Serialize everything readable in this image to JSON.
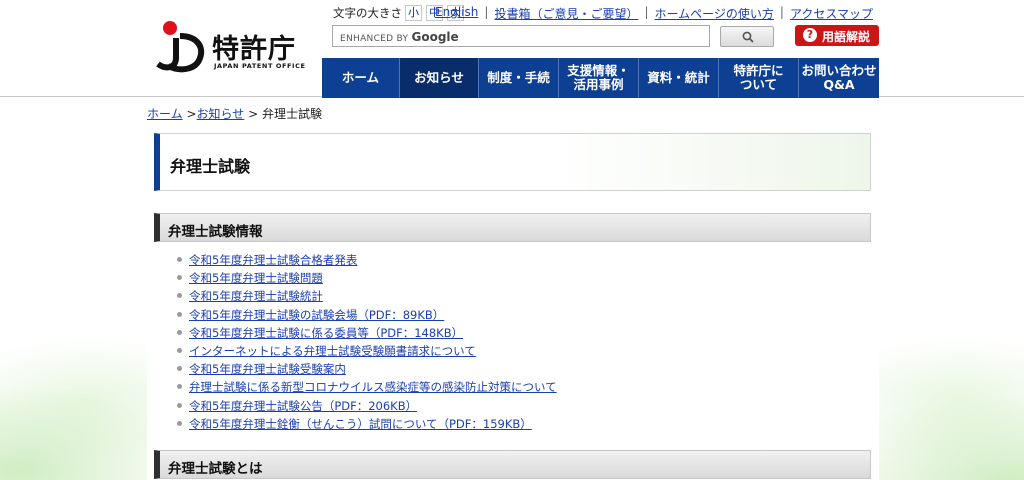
{
  "header": {
    "logo_text": "特許庁",
    "logo_subtext": "JAPAN PATENT OFFICE",
    "font_size_label": "文字の大きさ",
    "font_sizes": [
      "小",
      "中",
      "大"
    ],
    "util_links": [
      "English",
      "投書箱（ご意見・ご要望）",
      "ホームページの使い方",
      "アクセスマップ"
    ],
    "search_placeholder_prefix": "ENHANCED BY",
    "search_placeholder_brand": "Google",
    "glossary_label": "用語解説"
  },
  "nav": {
    "items": [
      {
        "label": "ホーム",
        "active": false
      },
      {
        "label": "お知らせ",
        "active": true
      },
      {
        "label": "制度・手続",
        "active": false
      },
      {
        "label": "支援情報・\n活用事例",
        "active": false
      },
      {
        "label": "資料・統計",
        "active": false
      },
      {
        "label": "特許庁に\nついて",
        "active": false
      },
      {
        "label": "お問い合わせ\nQ&A",
        "active": false
      }
    ]
  },
  "breadcrumb": {
    "home": "ホーム",
    "news": "お知らせ",
    "current": "弁理士試験"
  },
  "main": {
    "page_title": "弁理士試験",
    "section1_title": "弁理士試験情報",
    "links": [
      "令和5年度弁理士試験合格者発表",
      "令和5年度弁理士試験問題",
      "令和5年度弁理士試験統計",
      "令和5年度弁理士試験の試験会場（PDF：89KB）",
      "令和5年度弁理士試験に係る委員等（PDF：148KB）",
      "インターネットによる弁理士試験受験願書請求について",
      "令和5年度弁理士試験受験案内",
      "弁理士試験に係る新型コロナウイルス感染症等の感染防止対策について",
      "令和5年度弁理士試験公告（PDF：206KB）",
      "令和5年度弁理士銓衡（せんこう）試問について（PDF：159KB）"
    ],
    "section2_title": "弁理士試験とは"
  },
  "colors": {
    "nav_bg": "#0d3f92",
    "nav_active_bg": "#092c6a",
    "link": "#1a3fb0",
    "glossary_bg": "#cc1515",
    "logo_red": "#e0101c"
  },
  "icons": {
    "search_button": "magnifier-icon",
    "glossary": "question-circle-icon",
    "logo": "jpo-logo-mark"
  }
}
